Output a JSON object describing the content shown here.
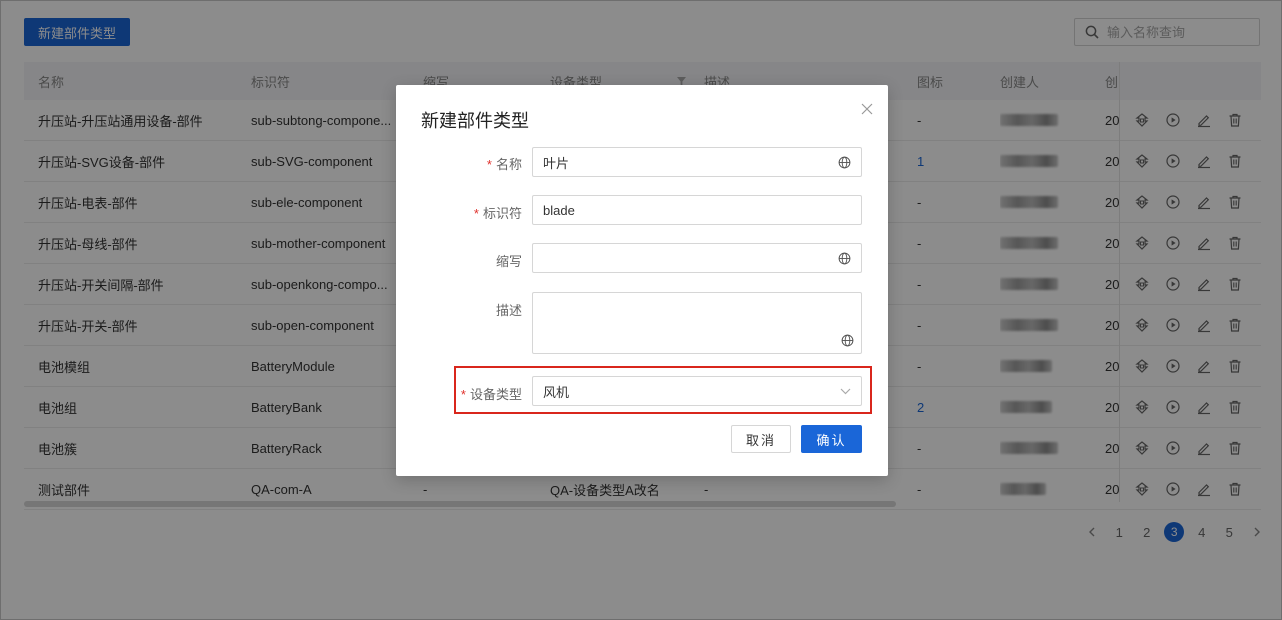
{
  "toolbar": {
    "new_button": "新建部件类型",
    "search_placeholder": "输入名称查询"
  },
  "table": {
    "headers": {
      "name": "名称",
      "ident": "标识符",
      "abbr": "缩写",
      "type": "设备类型",
      "desc": "描述",
      "icon": "图标",
      "creator": "创建人",
      "date": "创"
    },
    "rows": [
      {
        "name": "升压站-升压站通用设备-部件",
        "ident": "sub-subtong-compone...",
        "abbr": "",
        "type": "",
        "desc": "",
        "icon": "-",
        "date": "20"
      },
      {
        "name": "升压站-SVG设备-部件",
        "ident": "sub-SVG-component",
        "abbr": "",
        "type": "",
        "desc": "",
        "icon": "1",
        "date": "20"
      },
      {
        "name": "升压站-电表-部件",
        "ident": "sub-ele-component",
        "abbr": "",
        "type": "",
        "desc": "",
        "icon": "-",
        "date": "20"
      },
      {
        "name": "升压站-母线-部件",
        "ident": "sub-mother-component",
        "abbr": "",
        "type": "",
        "desc": "",
        "icon": "-",
        "date": "20"
      },
      {
        "name": "升压站-开关间隔-部件",
        "ident": "sub-openkong-compo...",
        "abbr": "",
        "type": "",
        "desc": "",
        "icon": "-",
        "date": "20"
      },
      {
        "name": "升压站-开关-部件",
        "ident": "sub-open-component",
        "abbr": "",
        "type": "",
        "desc": "",
        "icon": "-",
        "date": "20"
      },
      {
        "name": "电池模组",
        "ident": "BatteryModule",
        "abbr": "",
        "type": "",
        "desc": "",
        "icon": "-",
        "date": "20"
      },
      {
        "name": "电池组",
        "ident": "BatteryBank",
        "abbr": "",
        "type": "",
        "desc": "",
        "icon": "2",
        "date": "20"
      },
      {
        "name": "电池簇",
        "ident": "BatteryRack",
        "abbr": "",
        "type": "",
        "desc": "",
        "icon": "-",
        "date": "20"
      },
      {
        "name": "测试部件",
        "ident": "QA-com-A",
        "abbr": "-",
        "type": "QA-设备类型A改名",
        "desc": "-",
        "icon": "-",
        "date": "20"
      }
    ]
  },
  "pagination": {
    "pages": [
      "1",
      "2",
      "3",
      "4",
      "5"
    ],
    "current": "3"
  },
  "modal": {
    "title": "新建部件类型",
    "fields": {
      "name": {
        "label": "名称",
        "value": "叶片",
        "required": "*"
      },
      "ident": {
        "label": "标识符",
        "value": "blade",
        "required": "*"
      },
      "abbr": {
        "label": "缩写",
        "value": ""
      },
      "desc": {
        "label": "描述",
        "value": ""
      },
      "device_type": {
        "label": "设备类型",
        "value": "风机",
        "required": "*"
      }
    },
    "cancel": "取消",
    "ok": "确认"
  },
  "colors": {
    "primary": "#1a66d8",
    "required": "#e0302b",
    "highlight": "#d9261c"
  },
  "icons": [
    "search-icon",
    "filter-icon",
    "tree-icon",
    "play-icon",
    "edit-icon",
    "delete-icon",
    "close-icon",
    "globe-icon",
    "chevron-down-icon",
    "chevron-left-icon",
    "chevron-right-icon"
  ]
}
